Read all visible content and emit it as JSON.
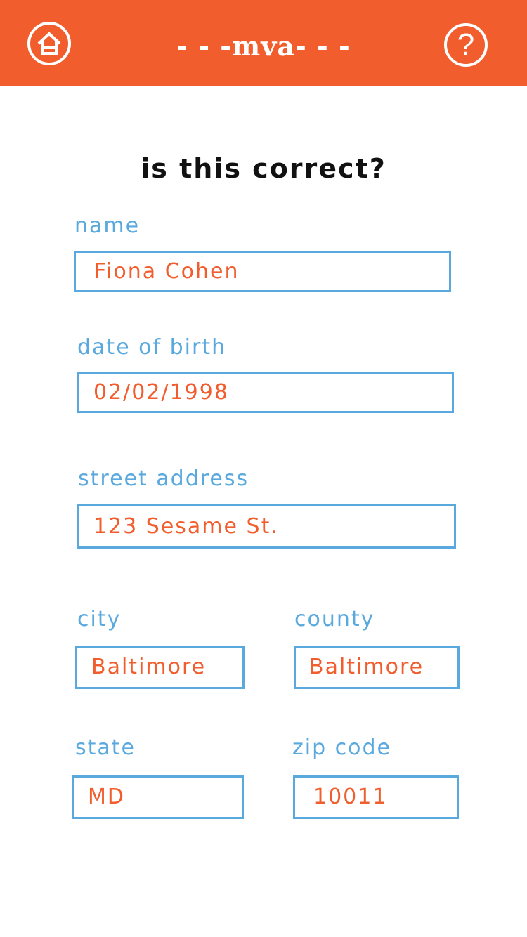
{
  "header": {
    "brand": "- - -mva- - -",
    "home_icon": "home-icon",
    "help_icon": "question-mark-icon",
    "help_glyph": "?"
  },
  "question": "is this correct?",
  "form": {
    "name": {
      "label": "name",
      "value": "Fiona Cohen"
    },
    "dob": {
      "label": "date of birth",
      "value": "02/02/1998"
    },
    "street": {
      "label": "street address",
      "value": "123 Sesame St."
    },
    "city": {
      "label": "city",
      "value": "Baltimore"
    },
    "county": {
      "label": "county",
      "value": "Baltimore"
    },
    "state": {
      "label": "state",
      "value": "MD"
    },
    "zip": {
      "label": "zip code",
      "value": "10011"
    }
  },
  "colors": {
    "header": "#f15d2d",
    "label": "#5aa9de",
    "value": "#f15d2d",
    "heading": "#111111"
  }
}
